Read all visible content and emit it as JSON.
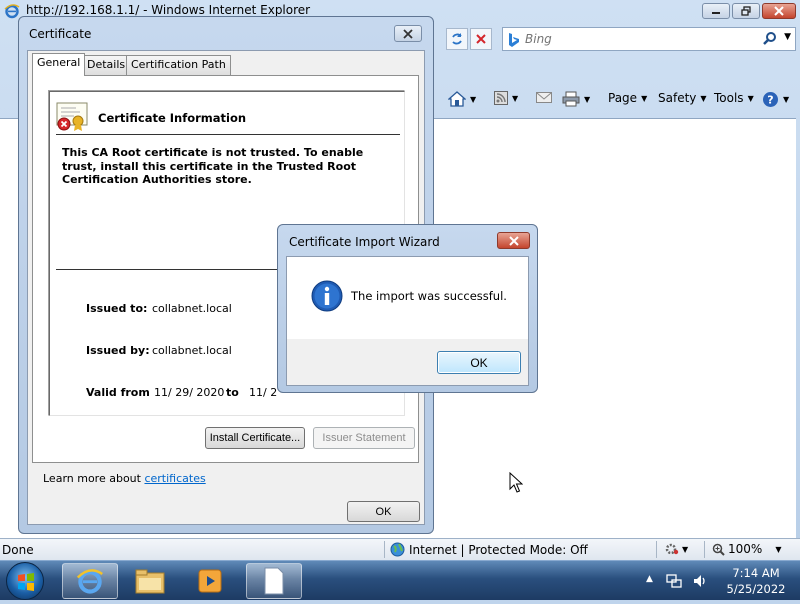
{
  "ie": {
    "window_title": "http://192.168.1.1/ - Windows Internet Explorer",
    "search_placeholder": "Bing",
    "commands": {
      "page": "Page",
      "safety": "Safety",
      "tools": "Tools"
    },
    "status": {
      "left": "Done",
      "zone": "Internet | Protected Mode: Off",
      "zoom": "100%"
    }
  },
  "certificate": {
    "title": "Certificate",
    "tabs": [
      "General",
      "Details",
      "Certification Path"
    ],
    "info_title": "Certificate Information",
    "warning": "This CA Root certificate is not trusted. To enable trust, install this certificate in the Trusted Root Certification Authorities store.",
    "issued_to_label": "Issued to:",
    "issued_to_value": "collabnet.local",
    "issued_by_label": "Issued by:",
    "issued_by_value": "collabnet.local",
    "valid_from_label": "Valid from",
    "valid_from_value": "11/ 29/ 2020",
    "valid_to_label": "to",
    "valid_to_value": "11/ 2",
    "install_button": "Install Certificate...",
    "issuer_button": "Issuer Statement",
    "learn_more_prefix": "Learn more about ",
    "learn_more_link": "certificates",
    "ok_button": "OK"
  },
  "wizard": {
    "title": "Certificate Import Wizard",
    "message": "The import was successful.",
    "ok_button": "OK"
  },
  "taskbar": {
    "time": "7:14 AM",
    "date": "5/25/2022"
  },
  "colors": {
    "link": "#0066cc",
    "close_button": "#c4452e",
    "taskbar": "#2a4f7e"
  }
}
